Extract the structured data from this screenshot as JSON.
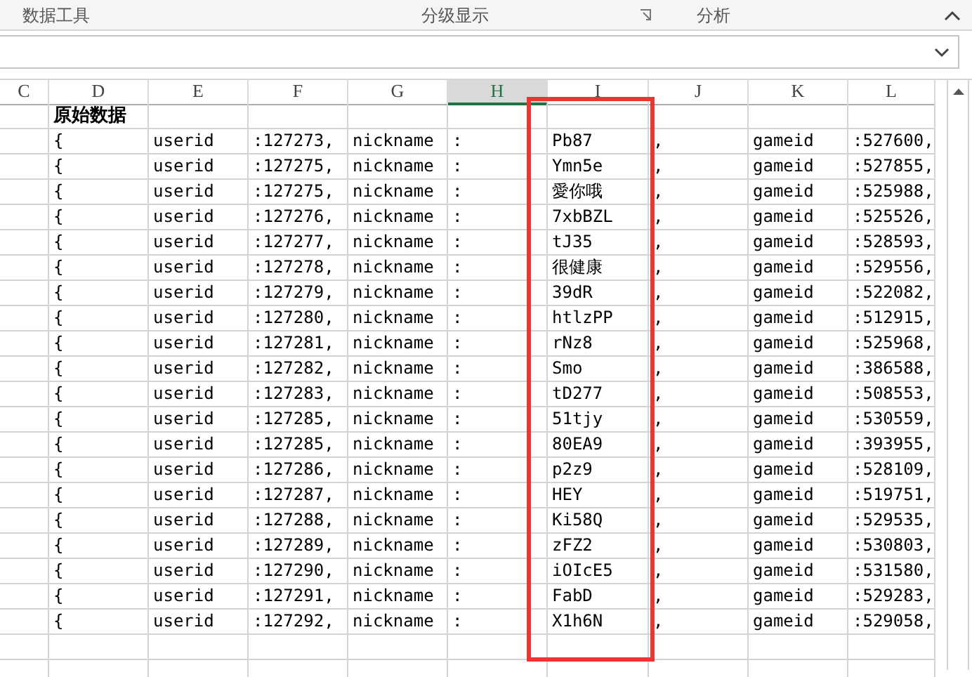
{
  "ribbon": {
    "groups": [
      "数据工具",
      "分级显示",
      "分析"
    ]
  },
  "sheet": {
    "columns": [
      {
        "letter": "C",
        "selected": false
      },
      {
        "letter": "D",
        "selected": false
      },
      {
        "letter": "E",
        "selected": false
      },
      {
        "letter": "F",
        "selected": false
      },
      {
        "letter": "G",
        "selected": false
      },
      {
        "letter": "H",
        "selected": true
      },
      {
        "letter": "I",
        "selected": false
      },
      {
        "letter": "J",
        "selected": false
      },
      {
        "letter": "K",
        "selected": false
      },
      {
        "letter": "L",
        "selected": false
      }
    ],
    "rows": [
      {
        "D": "原始数据"
      },
      {
        "D": "{",
        "E": "userid",
        "F": ":127273,",
        "G": "nickname",
        "H": ":",
        "I": "Pb87",
        "J": ",",
        "K": "gameid",
        "L": ":527600,"
      },
      {
        "D": "{",
        "E": "userid",
        "F": ":127275,",
        "G": "nickname",
        "H": ":",
        "I": "Ymn5e",
        "J": ",",
        "K": "gameid",
        "L": ":527855,"
      },
      {
        "D": "{",
        "E": "userid",
        "F": ":127275,",
        "G": "nickname",
        "H": ":",
        "I": "愛你哦",
        "J": ",",
        "K": "gameid",
        "L": ":525988,"
      },
      {
        "D": "{",
        "E": "userid",
        "F": ":127276,",
        "G": "nickname",
        "H": ":",
        "I": "7xbBZL",
        "J": ",",
        "K": "gameid",
        "L": ":525526,"
      },
      {
        "D": "{",
        "E": "userid",
        "F": ":127277,",
        "G": "nickname",
        "H": ":",
        "I": "tJ35",
        "J": ",",
        "K": "gameid",
        "L": ":528593,"
      },
      {
        "D": "{",
        "E": "userid",
        "F": ":127278,",
        "G": "nickname",
        "H": ":",
        "I": "很健康",
        "J": ",",
        "K": "gameid",
        "L": ":529556,"
      },
      {
        "D": "{",
        "E": "userid",
        "F": ":127279,",
        "G": "nickname",
        "H": ":",
        "I": "39dR",
        "J": ",",
        "K": "gameid",
        "L": ":522082,"
      },
      {
        "D": "{",
        "E": "userid",
        "F": ":127280,",
        "G": "nickname",
        "H": ":",
        "I": "htlzPP",
        "J": ",",
        "K": "gameid",
        "L": ":512915,"
      },
      {
        "D": "{",
        "E": "userid",
        "F": ":127281,",
        "G": "nickname",
        "H": ":",
        "I": "rNz8",
        "J": ",",
        "K": "gameid",
        "L": ":525968,"
      },
      {
        "D": "{",
        "E": "userid",
        "F": ":127282,",
        "G": "nickname",
        "H": ":",
        "I": "Smo",
        "J": ",",
        "K": "gameid",
        "L": ":386588,"
      },
      {
        "D": "{",
        "E": "userid",
        "F": ":127283,",
        "G": "nickname",
        "H": ":",
        "I": "tD277",
        "J": ",",
        "K": "gameid",
        "L": ":508553,"
      },
      {
        "D": "{",
        "E": "userid",
        "F": ":127285,",
        "G": "nickname",
        "H": ":",
        "I": "51tjy",
        "J": ",",
        "K": "gameid",
        "L": ":530559,"
      },
      {
        "D": "{",
        "E": "userid",
        "F": ":127285,",
        "G": "nickname",
        "H": ":",
        "I": "80EA9",
        "J": ",",
        "K": "gameid",
        "L": ":393955,"
      },
      {
        "D": "{",
        "E": "userid",
        "F": ":127286,",
        "G": "nickname",
        "H": ":",
        "I": "p2z9",
        "J": ",",
        "K": "gameid",
        "L": ":528109,"
      },
      {
        "D": "{",
        "E": "userid",
        "F": ":127287,",
        "G": "nickname",
        "H": ":",
        "I": "HEY",
        "J": ",",
        "K": "gameid",
        "L": ":519751,"
      },
      {
        "D": "{",
        "E": "userid",
        "F": ":127288,",
        "G": "nickname",
        "H": ":",
        "I": "Ki58Q",
        "J": ",",
        "K": "gameid",
        "L": ":529535,"
      },
      {
        "D": "{",
        "E": "userid",
        "F": ":127289,",
        "G": "nickname",
        "H": ":",
        "I": "zFZ2",
        "J": ",",
        "K": "gameid",
        "L": ":530803,"
      },
      {
        "D": "{",
        "E": "userid",
        "F": ":127290,",
        "G": "nickname",
        "H": ":",
        "I": "iOIcE5",
        "J": ",",
        "K": "gameid",
        "L": ":531580,"
      },
      {
        "D": "{",
        "E": "userid",
        "F": ":127291,",
        "G": "nickname",
        "H": ":",
        "I": "FabD",
        "J": ",",
        "K": "gameid",
        "L": ":529283,"
      },
      {
        "D": "{",
        "E": "userid",
        "F": ":127292,",
        "G": "nickname",
        "H": ":",
        "I": "X1h6N",
        "J": ",",
        "K": "gameid",
        "L": ":529058,"
      }
    ]
  }
}
